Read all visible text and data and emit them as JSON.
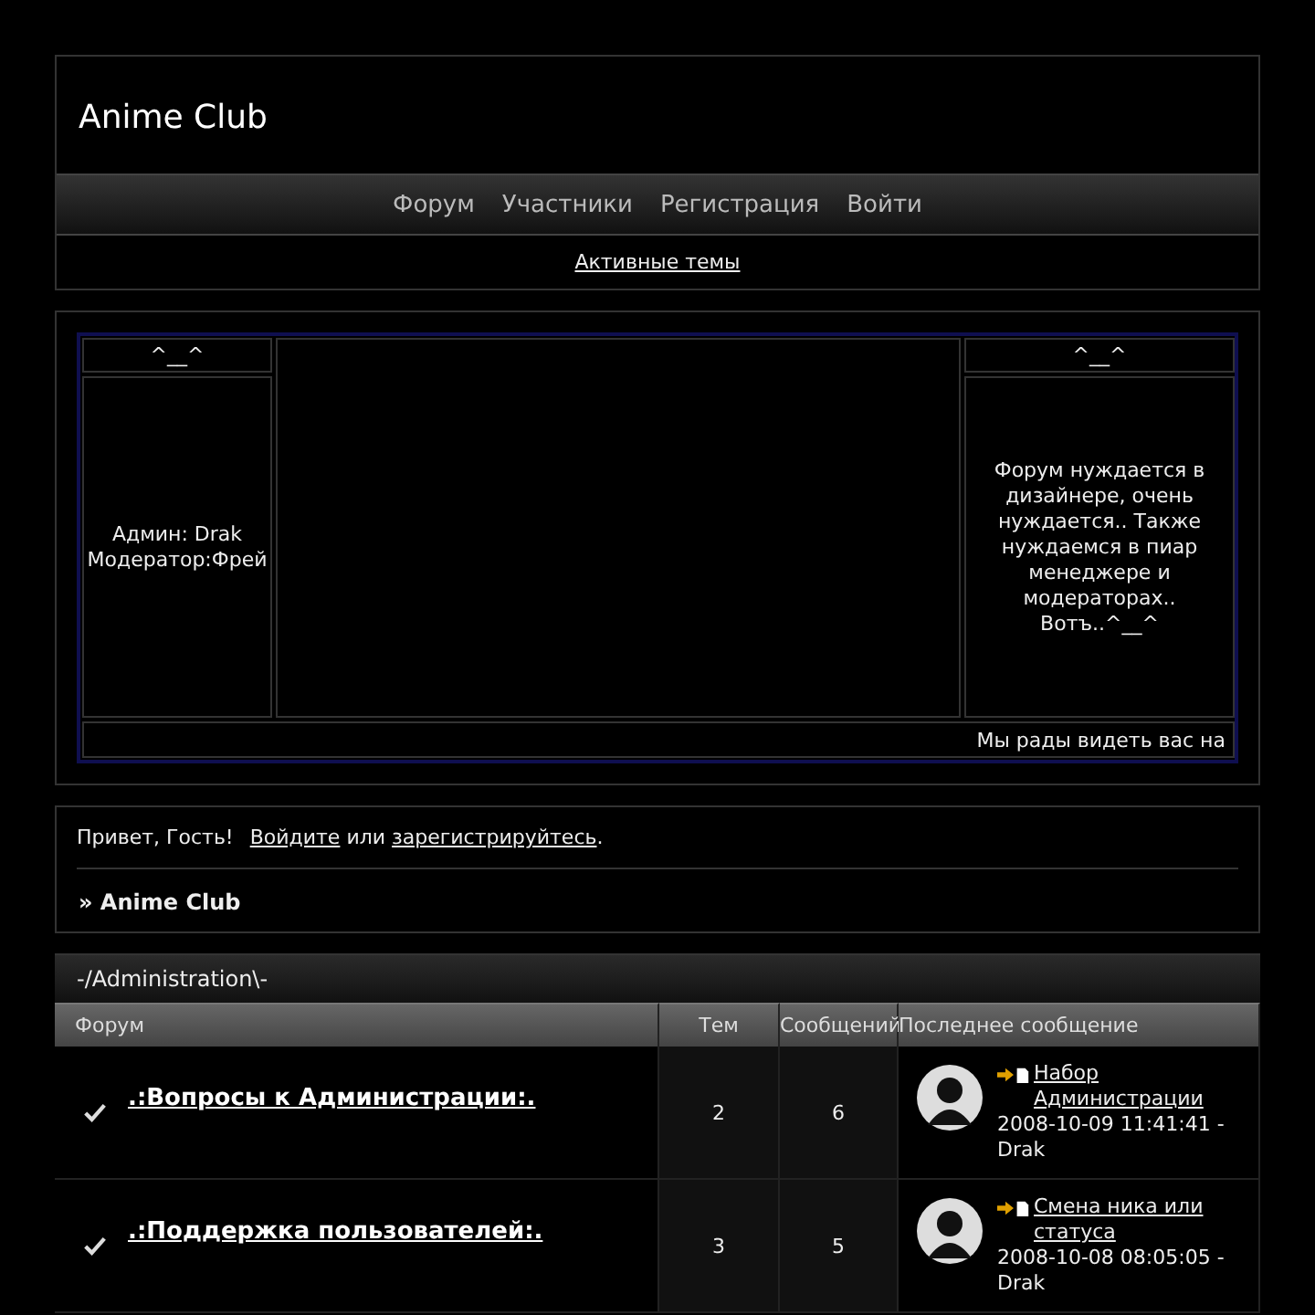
{
  "header": {
    "title": "Anime Club",
    "nav": [
      "Форум",
      "Участники",
      "Регистрация",
      "Войти"
    ],
    "active_topics": "Активные темы"
  },
  "info_panel": {
    "left_title": "^__^",
    "left_text": [
      "Админ: Drak",
      "Модератор:Фрей"
    ],
    "right_title": "^__^",
    "right_text": "Форум нуждается в дизайнере, очень нуждается.. Также нуждаемся в пиар менеджере и модераторах.. Вотъ..^__^",
    "marquee": "Мы рады видеть вас на"
  },
  "welcome": {
    "greeting": "Привет, Гость!",
    "login_link": "Войдите",
    "or": "или",
    "register_link": "зарегистрируйтесь",
    "end": ".",
    "breadcrumb": "» Anime Club"
  },
  "category": {
    "title": "-/Administration\\-",
    "columns": [
      "Форум",
      "Тем",
      "Сообщений",
      "Последнее сообщение"
    ],
    "rows": [
      {
        "forum": ".:Вопросы к Администрации:.",
        "topics": "2",
        "posts": "6",
        "last_topic": "Набор Администрации",
        "last_time": "2008-10-09 11:41:41 - Drak"
      },
      {
        "forum": ".:Поддержка пользователей:.",
        "topics": "3",
        "posts": "5",
        "last_topic": "Смена ника или статуса",
        "last_time": "2008-10-08 08:05:05 - Drak"
      }
    ]
  }
}
